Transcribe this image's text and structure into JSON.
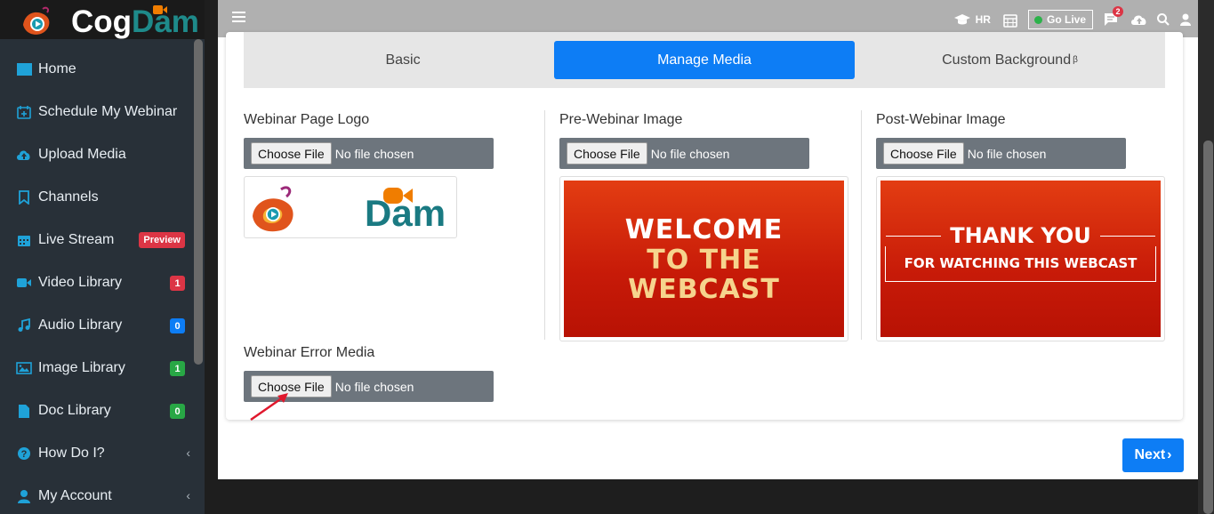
{
  "brand": {
    "logo_cog": "Cog",
    "logo_dam": "Dam"
  },
  "sidebar": {
    "items": [
      {
        "label": "Home",
        "icon": "home-icon"
      },
      {
        "label": "Schedule My Webinar",
        "icon": "calendar-plus-icon"
      },
      {
        "label": "Upload Media",
        "icon": "cloud-upload-icon"
      },
      {
        "label": "Channels",
        "icon": "bookmark-icon"
      },
      {
        "label": "Live Stream",
        "icon": "calendar-grid-icon",
        "badge": "Preview"
      },
      {
        "label": "Video Library",
        "icon": "video-camera-icon",
        "badge": "1"
      },
      {
        "label": "Audio Library",
        "icon": "music-note-icon",
        "badge": "0"
      },
      {
        "label": "Image Library",
        "icon": "image-icon",
        "badge": "1"
      },
      {
        "label": "Doc Library",
        "icon": "document-icon",
        "badge": "0"
      },
      {
        "label": "How Do I?",
        "icon": "question-circle-icon"
      },
      {
        "label": "My Account",
        "icon": "user-icon"
      }
    ]
  },
  "topbar": {
    "hr_label": "HR",
    "golive_label": "Go Live",
    "notification_count": "2"
  },
  "tabs": [
    {
      "label": "Basic"
    },
    {
      "label": "Manage Media"
    },
    {
      "label": "Custom Background",
      "sup": "β"
    }
  ],
  "media": {
    "logo": {
      "label": "Webinar Page Logo",
      "button": "Choose File",
      "status": "No file chosen"
    },
    "pre": {
      "label": "Pre-Webinar Image",
      "button": "Choose File",
      "status": "No file chosen"
    },
    "post": {
      "label": "Post-Webinar Image",
      "button": "Choose File",
      "status": "No file chosen"
    },
    "error": {
      "label": "Webinar Error Media",
      "button": "Choose File",
      "status": "No file chosen"
    }
  },
  "pre_poster": {
    "line1": "WELCOME",
    "line2": "TO THE",
    "line3": "WEBCAST"
  },
  "post_poster": {
    "title": "THANK YOU",
    "subtitle": "FOR WATCHING THIS WEBCAST"
  },
  "preview_logo": {
    "text": "Dam"
  },
  "next_label": "Next",
  "colors": {
    "accent": "#0d7df5",
    "sidebar": "#283038",
    "badge_red": "#dc3545",
    "badge_green": "#28a745"
  }
}
